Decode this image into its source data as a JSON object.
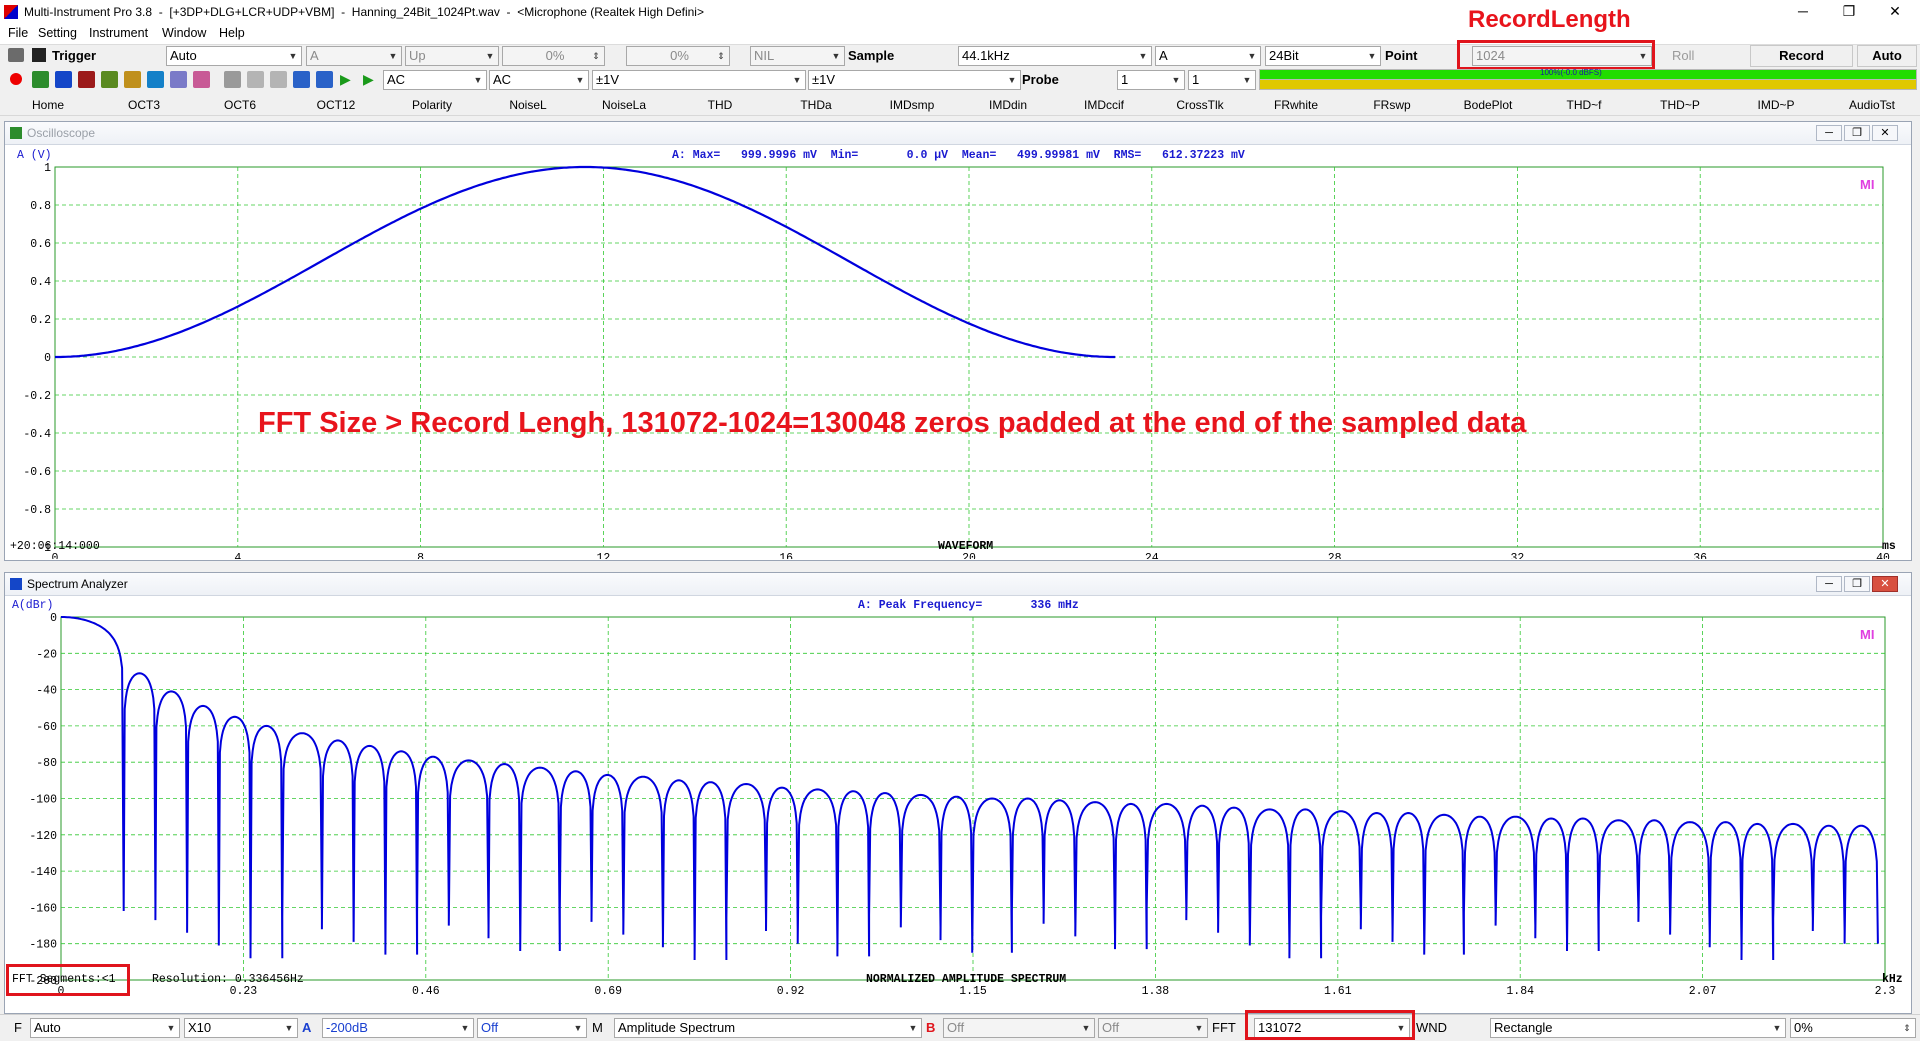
{
  "window": {
    "title": "Multi-Instrument Pro 3.8  -  [+3DP+DLG+LCR+UDP+VBM]  -  Hanning_24Bit_1024Pt.wav  -  <Microphone (Realtek High Defini>",
    "minimize": "─",
    "maximize": "❐",
    "close": "✕"
  },
  "menu": [
    "File",
    "Setting",
    "Instrument",
    "Window",
    "Help"
  ],
  "toolbar1": {
    "trigger_label": "Trigger",
    "trigger_mode": "Auto",
    "trigger_channel": "A",
    "trigger_edge": "Up",
    "trigger_level": "0%",
    "trigger_delay": "0%",
    "nil": "NIL",
    "sample_label": "Sample",
    "sample_rate": "44.1kHz",
    "channel": "A",
    "bits": "24Bit",
    "point_label": "Point",
    "record_length": "1024",
    "roll_label": "Roll",
    "record_button": "Record",
    "auto_button": "Auto"
  },
  "toolbar2": {
    "coupling_a": "AC",
    "coupling_b": "AC",
    "range_a": "±1V",
    "range_b": "±1V",
    "probe_label": "Probe",
    "probe_a": "1",
    "probe_b": "1",
    "level_text": "100%(-0.0 dBFS)",
    "level_fraction": 1.0
  },
  "tabs": [
    "Home",
    "OCT3",
    "OCT6",
    "OCT12",
    "Polarity",
    "NoiseL",
    "NoiseLa",
    "THD",
    "THDa",
    "IMDsmp",
    "IMDdin",
    "IMDccif",
    "CrossTlk",
    "FRwhite",
    "FRswp",
    "BodePlot",
    "THD~f",
    "THD~P",
    "IMD~P",
    "AudioTst"
  ],
  "oscilloscope": {
    "title": "Oscilloscope",
    "channel_unit": "A (V)",
    "stats": "A: Max=   999.9996 mV  Min=       0.0 µV  Mean=   499.99981 mV  RMS=   612.37223 mV",
    "mi_logo": "MI",
    "timestamp": "+20:06:14:000",
    "xlabel": "WAVEFORM",
    "xunit": "ms",
    "annotation": "FFT Size > Record Lengh, 131072-1024=130048 zeros padded at the end of the sampled data"
  },
  "spectrum": {
    "title": "Spectrum Analyzer",
    "channel_unit": "A(dBr)",
    "peak": "A: Peak Frequency=       336 mHz",
    "mi_logo": "MI",
    "fft_segments": "FFT Segments:<1",
    "resolution": "Resolution: 0.336456Hz",
    "xlabel": "NORMALIZED AMPLITUDE SPECTRUM",
    "xunit": "kHz"
  },
  "annotations": {
    "record_length": "RecordLength"
  },
  "bottombar": {
    "f_label": "F",
    "f_mode": "Auto",
    "zoom": "X10",
    "a_label": "A",
    "a_range": "-200dB",
    "a_off": "Off",
    "m_label": "M",
    "m_mode": "Amplitude Spectrum",
    "b_label": "B",
    "b_off1": "Off",
    "b_off2": "Off",
    "fft_label": "FFT",
    "fft_size": "131072",
    "wnd_label": "WND",
    "window": "Rectangle",
    "overlap": "0%"
  },
  "chart_data": [
    {
      "type": "line",
      "title": "",
      "xlabel": "WAVEFORM",
      "ylabel": "A (V)",
      "xlim": [
        0,
        40
      ],
      "ylim": [
        -1,
        1
      ],
      "x_unit": "ms",
      "x_ticks": [
        0,
        4,
        8,
        12,
        16,
        20,
        24,
        28,
        32,
        36,
        40
      ],
      "y_ticks": [
        1,
        0.8,
        0.6,
        0.4,
        0.2,
        0,
        -0.2,
        -0.4,
        -0.6,
        -0.8,
        -1
      ],
      "grid": true,
      "series": [
        {
          "color": "#0000dd",
          "x": [
            0,
            1.16,
            2.32,
            3.48,
            4.64,
            5.8,
            6.96,
            8.12,
            9.28,
            10.44,
            11.6,
            12.76,
            13.92,
            15.08,
            16.24,
            17.4,
            18.56,
            19.72,
            20.88,
            22.04,
            23.2
          ],
          "y": [
            0,
            0.024,
            0.095,
            0.206,
            0.345,
            0.5,
            0.655,
            0.794,
            0.905,
            0.976,
            1,
            0.976,
            0.905,
            0.794,
            0.655,
            0.5,
            0.345,
            0.206,
            0.095,
            0.024,
            0
          ]
        }
      ]
    },
    {
      "type": "line",
      "title": "",
      "xlabel": "NORMALIZED AMPLITUDE SPECTRUM",
      "ylabel": "A(dBr)",
      "xlim": [
        0,
        2.3
      ],
      "ylim": [
        -200,
        0
      ],
      "x_unit": "kHz",
      "x_ticks": [
        0,
        0.23,
        0.46,
        0.69,
        0.92,
        1.15,
        1.38,
        1.61,
        1.84,
        2.07,
        2.3
      ],
      "y_ticks": [
        0,
        -20,
        -40,
        -60,
        -80,
        -100,
        -120,
        -140,
        -160,
        -180,
        -200
      ],
      "grid": true,
      "series": [
        {
          "color": "#0000dd",
          "peaks_x_khz": [
            0,
            0.1,
            0.14,
            0.18,
            0.22,
            0.26,
            0.3,
            0.35,
            0.39,
            0.43,
            0.47,
            0.51,
            0.56,
            0.6,
            0.65,
            0.69,
            0.73,
            0.78,
            0.82,
            0.86,
            0.91,
            0.95,
            1.0,
            1.04,
            1.08,
            1.13,
            1.17,
            1.22,
            1.26,
            1.3,
            1.35,
            1.39,
            1.44,
            1.48,
            1.52,
            1.57,
            1.61,
            1.66,
            1.7,
            1.74,
            1.79,
            1.83,
            1.88,
            1.92,
            1.96,
            2.01,
            2.05,
            2.1,
            2.14,
            2.18,
            2.23,
            2.27
          ],
          "peaks_db": [
            0,
            -31,
            -41,
            -49,
            -55,
            -60,
            -64,
            -68,
            -71,
            -74,
            -77,
            -79,
            -81,
            -83,
            -85,
            -87,
            -88,
            -90,
            -91,
            -92,
            -94,
            -95,
            -96,
            -97,
            -98,
            -99,
            -100,
            -100,
            -101,
            -102,
            -103,
            -103,
            -104,
            -105,
            -106,
            -106,
            -107,
            -108,
            -108,
            -109,
            -110,
            -110,
            -111,
            -111,
            -112,
            -112,
            -113,
            -113,
            -114,
            -114,
            -115,
            -115
          ]
        }
      ]
    }
  ]
}
